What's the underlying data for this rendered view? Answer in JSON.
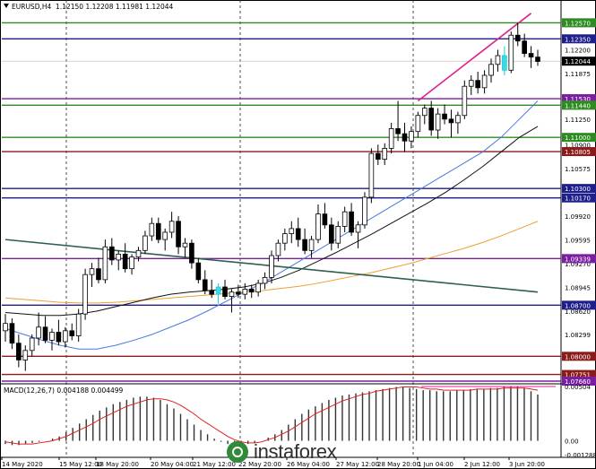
{
  "header": {
    "symbol": "EURUSD,H4",
    "ohlc": "1.12150 1.12208 1.11981 1.12044"
  },
  "macd": {
    "label": "MACD(12,26,7) 0.004188 0.004499",
    "scale_labels": [
      "0.00504",
      "0.00",
      "-0.001288"
    ]
  },
  "watermark": {
    "text": "instaforex"
  },
  "chart_data": {
    "type": "line",
    "title": "EURUSD,H4",
    "ylim": [
      1.0766,
      1.1271
    ],
    "x_ticks": [
      "14 May 2020",
      "15 May 12:00",
      "18 May 20:00",
      "20 May 04:00",
      "21 May 12:00",
      "22 May 20:00",
      "26 May 04:00",
      "27 May 12:00",
      "28 May 20:00",
      "1 Jun 04:00",
      "2 Jun 12:00",
      "3 Jun 20:00"
    ],
    "y_axis_labels": [
      "1.12570",
      "1.12350",
      "1.12200",
      "1.12044",
      "1.11875",
      "1.11530",
      "1.11440",
      "1.11250",
      "1.11000",
      "1.10900",
      "1.10805",
      "1.10575",
      "1.10300",
      "1.10170",
      "1.09920",
      "1.09595",
      "1.09339",
      "1.09270",
      "1.08945",
      "1.08700",
      "1.08620",
      "1.08299",
      "1.08000",
      "1.07751",
      "1.07660"
    ],
    "highlighted_levels": [
      {
        "value": 1.1257,
        "color": "#2e8b22"
      },
      {
        "value": 1.1235,
        "color": "#1e1e8c"
      },
      {
        "value": 1.1153,
        "color": "#7b1fa2"
      },
      {
        "value": 1.1144,
        "color": "#2e8b22"
      },
      {
        "value": 1.11,
        "color": "#2e8b22"
      },
      {
        "value": 1.10805,
        "color": "#8b1a1a"
      },
      {
        "value": 1.103,
        "color": "#1e1e8c"
      },
      {
        "value": 1.1017,
        "color": "#1e1e8c"
      },
      {
        "value": 1.09339,
        "color": "#7b1fa2"
      },
      {
        "value": 1.087,
        "color": "#1e1e8c"
      },
      {
        "value": 1.08,
        "color": "#8b1a1a"
      },
      {
        "value": 1.07751,
        "color": "#8b1a1a"
      },
      {
        "value": 1.0766,
        "color": "#7b1fa2"
      }
    ],
    "current_price": 1.12044,
    "candles": [
      [
        1.0835,
        1.0858,
        1.082,
        1.0845
      ],
      [
        1.0845,
        1.0852,
        1.081,
        1.0818
      ],
      [
        1.0818,
        1.083,
        1.0785,
        1.0795
      ],
      [
        1.0795,
        1.0815,
        1.078,
        1.0808
      ],
      [
        1.0808,
        1.083,
        1.08,
        1.0825
      ],
      [
        1.0825,
        1.086,
        1.0815,
        1.084
      ],
      [
        1.084,
        1.0855,
        1.0818,
        1.0822
      ],
      [
        1.0822,
        1.0838,
        1.0808,
        1.0833
      ],
      [
        1.0833,
        1.085,
        1.0815,
        1.082
      ],
      [
        1.082,
        1.084,
        1.0812,
        1.0835
      ],
      [
        1.0835,
        1.0845,
        1.0822,
        1.0828
      ],
      [
        1.0828,
        1.0865,
        1.082,
        1.0858
      ],
      [
        1.0858,
        1.092,
        1.085,
        1.0912
      ],
      [
        1.0912,
        1.0928,
        1.0895,
        1.092
      ],
      [
        1.092,
        1.0935,
        1.09,
        1.0905
      ],
      [
        1.0905,
        1.096,
        1.09,
        1.095
      ],
      [
        1.095,
        1.0962,
        1.0925,
        1.0932
      ],
      [
        1.0932,
        1.0945,
        1.0918,
        1.094
      ],
      [
        1.094,
        1.0955,
        1.0915,
        1.092
      ],
      [
        1.092,
        1.094,
        1.0912,
        1.0936
      ],
      [
        1.0936,
        1.095,
        1.093,
        1.0945
      ],
      [
        1.0945,
        1.0972,
        1.094,
        1.0965
      ],
      [
        1.0965,
        1.099,
        1.0958,
        1.0982
      ],
      [
        1.0982,
        1.099,
        1.0955,
        1.096
      ],
      [
        1.096,
        1.0975,
        1.0945,
        1.097
      ],
      [
        1.097,
        1.0998,
        1.0962,
        1.0985
      ],
      [
        1.0985,
        1.0992,
        1.094,
        1.095
      ],
      [
        1.095,
        1.0962,
        1.0935,
        1.0955
      ],
      [
        1.0955,
        1.096,
        1.092,
        1.0928
      ],
      [
        1.0928,
        1.0935,
        1.09,
        1.0905
      ],
      [
        1.0905,
        1.0918,
        1.0885,
        1.089
      ],
      [
        1.089,
        1.0905,
        1.088,
        1.0885
      ],
      [
        1.0885,
        1.09,
        1.0872,
        1.0895
      ],
      [
        1.0895,
        1.0905,
        1.0878,
        1.0882
      ],
      [
        1.0882,
        1.0892,
        1.086,
        1.0888
      ],
      [
        1.0888,
        1.0898,
        1.088,
        1.0885
      ],
      [
        1.0885,
        1.09,
        1.0878,
        1.0892
      ],
      [
        1.0892,
        1.0898,
        1.088,
        1.0888
      ],
      [
        1.0888,
        1.0905,
        1.0882,
        1.09
      ],
      [
        1.09,
        1.0915,
        1.0892,
        1.0908
      ],
      [
        1.0908,
        1.0945,
        1.09,
        1.0938
      ],
      [
        1.0938,
        1.096,
        1.093,
        1.0955
      ],
      [
        1.0955,
        1.0975,
        1.0945,
        1.0968
      ],
      [
        1.0968,
        1.0985,
        1.0955,
        1.0975
      ],
      [
        1.0975,
        1.099,
        1.095,
        1.096
      ],
      [
        1.096,
        1.0975,
        1.094,
        1.0945
      ],
      [
        1.0945,
        1.0965,
        1.0935,
        1.096
      ],
      [
        1.096,
        1.1008,
        1.0955,
        1.0995
      ],
      [
        1.0995,
        1.101,
        1.0975,
        1.098
      ],
      [
        1.098,
        1.099,
        1.0945,
        1.0955
      ],
      [
        1.0955,
        1.0985,
        1.0948,
        1.0978
      ],
      [
        1.0978,
        1.1005,
        1.097,
        1.0998
      ],
      [
        1.0998,
        1.101,
        1.0965,
        1.097
      ],
      [
        1.097,
        1.0985,
        1.0948,
        1.098
      ],
      [
        1.098,
        1.1025,
        1.0975,
        1.1018
      ],
      [
        1.1018,
        1.1085,
        1.101,
        1.1078
      ],
      [
        1.1078,
        1.109,
        1.1062,
        1.107
      ],
      [
        1.107,
        1.1092,
        1.1062,
        1.1085
      ],
      [
        1.1085,
        1.112,
        1.1078,
        1.1112
      ],
      [
        1.1112,
        1.115,
        1.1095,
        1.1105
      ],
      [
        1.1105,
        1.112,
        1.108,
        1.1095
      ],
      [
        1.1095,
        1.1115,
        1.1085,
        1.1108
      ],
      [
        1.1108,
        1.1135,
        1.11,
        1.113
      ],
      [
        1.113,
        1.1145,
        1.1118,
        1.114
      ],
      [
        1.114,
        1.115,
        1.1102,
        1.111
      ],
      [
        1.111,
        1.114,
        1.1098,
        1.1132
      ],
      [
        1.1132,
        1.1145,
        1.1118,
        1.1125
      ],
      [
        1.1125,
        1.1138,
        1.11,
        1.112
      ],
      [
        1.112,
        1.1135,
        1.1105,
        1.113
      ],
      [
        1.113,
        1.1178,
        1.1125,
        1.117
      ],
      [
        1.117,
        1.1185,
        1.1158,
        1.1178
      ],
      [
        1.1178,
        1.119,
        1.116,
        1.1168
      ],
      [
        1.1168,
        1.1192,
        1.116,
        1.1185
      ],
      [
        1.1185,
        1.1208,
        1.1175,
        1.12
      ],
      [
        1.12,
        1.122,
        1.119,
        1.1212
      ],
      [
        1.1212,
        1.1225,
        1.1185,
        1.1192
      ],
      [
        1.1192,
        1.1245,
        1.1188,
        1.124
      ],
      [
        1.124,
        1.1257,
        1.1225,
        1.1232
      ],
      [
        1.1232,
        1.1242,
        1.121,
        1.1215
      ],
      [
        1.1215,
        1.1225,
        1.1195,
        1.121
      ],
      [
        1.121,
        1.122,
        1.1198,
        1.1204
      ]
    ],
    "sma_blue": [
      1.0838,
      1.083,
      1.0822,
      1.0815,
      1.081,
      1.081,
      1.0815,
      1.0822,
      1.083,
      1.084,
      1.085,
      1.0862,
      1.0875,
      1.0888,
      1.09,
      1.0915,
      1.093,
      1.0945,
      1.096,
      1.0975,
      1.099,
      1.1005,
      1.102,
      1.1035,
      1.105,
      1.1065,
      1.108,
      1.11,
      1.1125,
      1.115
    ],
    "sma_black": [
      1.086,
      1.0858,
      1.0856,
      1.0856,
      1.0858,
      1.0862,
      1.0868,
      1.0874,
      1.088,
      1.0885,
      1.0888,
      1.089,
      1.0892,
      1.0895,
      1.09,
      1.0908,
      1.0918,
      1.093,
      1.0942,
      1.0955,
      1.0968,
      1.0982,
      1.0996,
      1.101,
      1.1025,
      1.1042,
      1.106,
      1.108,
      1.11,
      1.1115
    ],
    "sma_orange": [
      1.088,
      1.0878,
      1.0876,
      1.0874,
      1.0873,
      1.0873,
      1.0874,
      1.0876,
      1.0878,
      1.088,
      1.0882,
      1.0884,
      1.0886,
      1.0888,
      1.089,
      1.0893,
      1.0896,
      1.09,
      1.0905,
      1.091,
      1.0915,
      1.0921,
      1.0927,
      1.0934,
      1.0941,
      1.0948,
      1.0956,
      1.0965,
      1.0975,
      1.0985
    ],
    "trendline_dark_green": {
      "start": [
        0,
        1.096
      ],
      "end": [
        80,
        1.0888
      ]
    },
    "trendline_magenta": {
      "start": [
        62,
        1.115
      ],
      "end": [
        79,
        1.127
      ]
    },
    "macd_histogram": [
      -0.0003,
      -0.0004,
      -0.0004,
      -0.0003,
      -0.0002,
      -0.0001,
      0.0,
      0.0002,
      0.0004,
      0.0008,
      0.0012,
      0.0016,
      0.002,
      0.0024,
      0.0028,
      0.0031,
      0.0034,
      0.0036,
      0.0038,
      0.004,
      0.0041,
      0.0041,
      0.004,
      0.0038,
      0.0034,
      0.003,
      0.0025,
      0.002,
      0.0015,
      0.001,
      0.0006,
      0.0002,
      -0.0001,
      -0.0003,
      -0.0004,
      -0.0004,
      -0.0003,
      -0.0002,
      0.0,
      0.0003,
      0.0006,
      0.001,
      0.0015,
      0.002,
      0.0025,
      0.0029,
      0.0032,
      0.0035,
      0.0038,
      0.004,
      0.0042,
      0.0043,
      0.0044,
      0.0045,
      0.0046,
      0.0047,
      0.0048,
      0.0049,
      0.005,
      0.005,
      0.0049,
      0.0048,
      0.0047,
      0.0047,
      0.0046,
      0.0046,
      0.0046,
      0.0047,
      0.0047,
      0.0048,
      0.0048,
      0.0048,
      0.0049,
      0.0049,
      0.005,
      0.005,
      0.005,
      0.0049,
      0.0046,
      0.0043
    ],
    "macd_signal": [
      -0.0001,
      -0.0002,
      -0.0003,
      -0.0003,
      -0.0003,
      -0.0002,
      -0.0001,
      0.0,
      0.0002,
      0.0004,
      0.0007,
      0.001,
      0.0013,
      0.0016,
      0.002,
      0.0023,
      0.0026,
      0.0029,
      0.0032,
      0.0034,
      0.0036,
      0.0038,
      0.0039,
      0.0039,
      0.0038,
      0.0036,
      0.0033,
      0.0029,
      0.0025,
      0.002,
      0.0016,
      0.0012,
      0.0008,
      0.0004,
      0.0001,
      -0.0001,
      -0.0002,
      -0.0002,
      -0.0001,
      0.0001,
      0.0003,
      0.0006,
      0.0009,
      0.0013,
      0.0017,
      0.0021,
      0.0025,
      0.0028,
      0.0031,
      0.0034,
      0.0037,
      0.0039,
      0.0041,
      0.0043,
      0.0044,
      0.0046,
      0.0047,
      0.0048,
      0.0049,
      0.005,
      0.005,
      0.005,
      0.0049,
      0.0048,
      0.0048,
      0.0047,
      0.0047,
      0.0047,
      0.0047,
      0.0047,
      0.0048,
      0.0048,
      0.0048,
      0.0048,
      0.0049,
      0.0049,
      0.0049,
      0.0049,
      0.0048,
      0.0047
    ],
    "macd_ylim": [
      -0.001288,
      0.00504
    ]
  }
}
